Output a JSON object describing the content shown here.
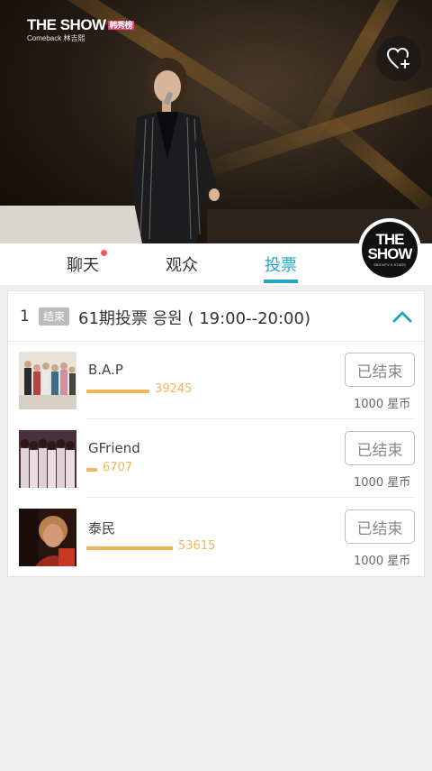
{
  "video": {
    "logo_brand": "THE SHOW",
    "logo_tag": "韩秀榜",
    "logo_sub": "Comeback 林吉熙",
    "favorite_icon": "heart-plus-icon"
  },
  "tabs": [
    {
      "label": "聊天",
      "active": false,
      "has_dot": true
    },
    {
      "label": "观众",
      "active": false,
      "has_dot": false
    },
    {
      "label": "投票",
      "active": true,
      "has_dot": false
    }
  ],
  "badge": {
    "line1": "THE",
    "line2": "SHOW",
    "tiny": "SBS MTV K-STARS"
  },
  "vote": {
    "index": "1",
    "status": "结束",
    "title": "61期投票 응원 ( 19:00--20:00)",
    "expanded": true,
    "entries": [
      {
        "name": "B.A.P",
        "votes": "39245",
        "vote_value": 39245,
        "button": "已结束",
        "cost": "1000 星币"
      },
      {
        "name": "GFriend",
        "votes": "6707",
        "vote_value": 6707,
        "button": "已结束",
        "cost": "1000 星币"
      },
      {
        "name": "泰民",
        "votes": "53615",
        "vote_value": 53615,
        "button": "已结束",
        "cost": "1000 星币"
      }
    ]
  },
  "colors": {
    "accent": "#1ea6c9",
    "vote_bar": "#f3b55a",
    "notification_dot": "#f05a5a"
  }
}
